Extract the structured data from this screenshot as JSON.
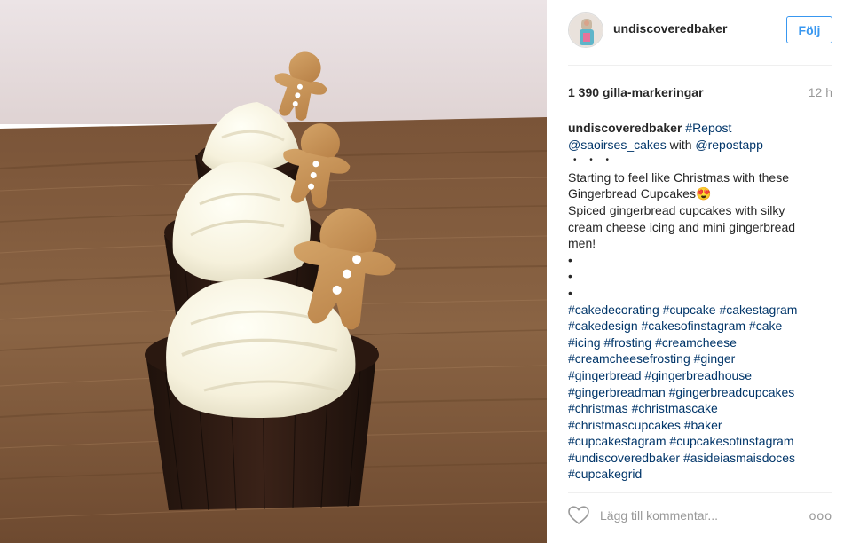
{
  "post": {
    "image_alt": "Gingerbread cupcakes with cream cheese frosting and mini gingerbread men",
    "username": "undiscoveredbaker",
    "follow_label": "Följ",
    "likes": "1 390 gilla-markeringar",
    "time": "12 h"
  },
  "caption": {
    "user": "undiscoveredbaker",
    "repost_tag": "#Repost",
    "mention_1": "@saoirses_cakes",
    "with_word": "with",
    "mention_2": "@repostapp",
    "dots": "• • •",
    "line_1": "Starting to feel like Christmas with these",
    "line_2": "Gingerbread Cupcakes😍",
    "line_3": "Spiced gingerbread cupcakes with silky",
    "line_4": "cream cheese icing and mini gingerbread",
    "line_5": "men!",
    "bullet_1": "•",
    "bullet_2": "•",
    "bullet_3": "•",
    "hashtags": [
      "#cakedecorating",
      "#cupcake",
      "#cakestagram",
      "#cakedesign",
      "#cakesofinstagram",
      "#cake",
      "#icing",
      "#frosting",
      "#creamcheese",
      "#creamcheesefrosting",
      "#ginger",
      "#gingerbread",
      "#gingerbreadhouse",
      "#gingerbreadman",
      "#gingerbreadcupcakes",
      "#christmas",
      "#christmascake",
      "#christmascupcakes",
      "#baker",
      "#cupcakestagram",
      "#cupcakesofinstagram",
      "#undiscoveredbaker",
      "#asideiasmaisdoces",
      "#cupcakegrid"
    ]
  },
  "comment": {
    "placeholder": "Lägg till kommentar...",
    "more_label": "ooo"
  },
  "icons": {
    "like": "heart-outline-icon",
    "more": "more-options-icon"
  },
  "colors": {
    "link": "#003569",
    "follow": "#3897f0",
    "muted": "#999999",
    "text": "#262626"
  }
}
